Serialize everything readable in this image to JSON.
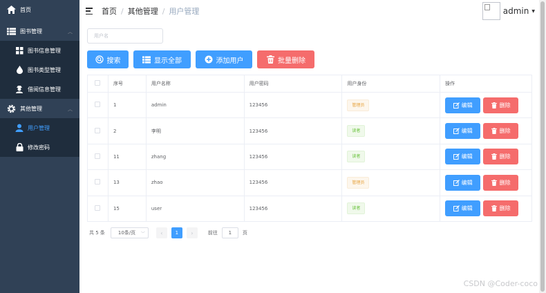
{
  "sidebar": {
    "home_label": "首页",
    "group1_label": "图书管理",
    "group1_items": [
      "图书信息管理",
      "图书类型管理",
      "借阅信息管理"
    ],
    "group2_label": "其他管理",
    "group2_items": [
      "用户管理",
      "修改密码"
    ]
  },
  "header": {
    "breadcrumb": [
      "首页",
      "其他管理",
      "用户管理"
    ],
    "username": "admin"
  },
  "search": {
    "placeholder": "用户名"
  },
  "toolbar": {
    "search_label": "搜索",
    "show_all_label": "显示全部",
    "add_user_label": "添加用户",
    "batch_delete_label": "批量删除"
  },
  "table": {
    "headers": [
      "序号",
      "用户名称",
      "用户密码",
      "用户身份",
      "操作"
    ],
    "edit_label": "编辑",
    "delete_label": "删除",
    "rows": [
      {
        "id": "1",
        "name": "admin",
        "password": "123456",
        "role": "管理员",
        "role_type": "admin"
      },
      {
        "id": "2",
        "name": "李明",
        "password": "123456",
        "role": "读者",
        "role_type": "reader"
      },
      {
        "id": "11",
        "name": "zhang",
        "password": "123456",
        "role": "读者",
        "role_type": "reader"
      },
      {
        "id": "13",
        "name": "zhao",
        "password": "123456",
        "role": "管理员",
        "role_type": "admin"
      },
      {
        "id": "15",
        "name": "user",
        "password": "123456",
        "role": "读者",
        "role_type": "reader"
      }
    ]
  },
  "pagination": {
    "total_text": "共 5 条",
    "page_size": "10条/页",
    "current_page": "1",
    "goto_prefix": "前往",
    "goto_value": "1",
    "goto_suffix": "页"
  },
  "watermark": "CSDN @Coder-coco",
  "colors": {
    "primary": "#409eff",
    "danger": "#f56c6c",
    "sidebar": "#304156"
  }
}
